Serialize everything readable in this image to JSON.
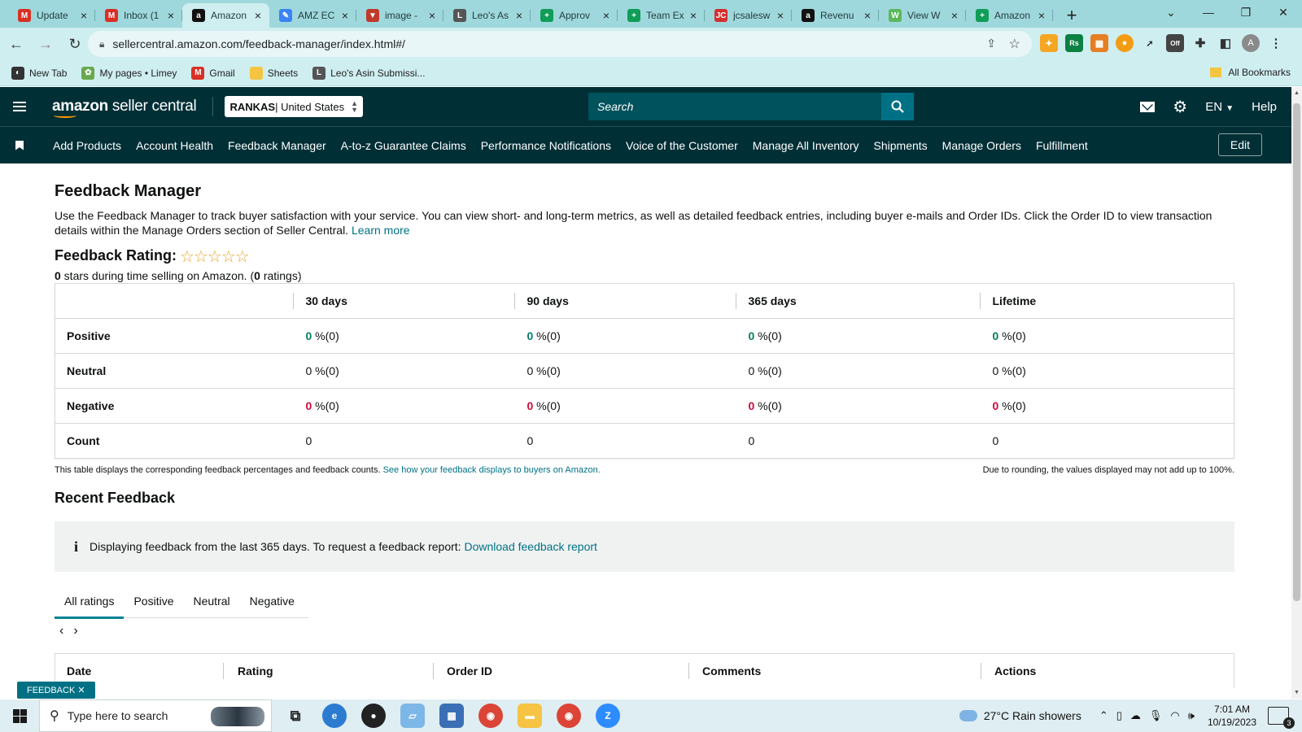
{
  "browser": {
    "tabs": [
      {
        "title": "Update",
        "icon": "gmail-icon",
        "color": "#d93025",
        "glyph": "M"
      },
      {
        "title": "Inbox (1",
        "icon": "gmail-icon",
        "color": "#d93025",
        "glyph": "M"
      },
      {
        "title": "Amazon",
        "icon": "amazon-icon",
        "color": "#111111",
        "glyph": "a"
      },
      {
        "title": "AMZ EC",
        "icon": "pen-icon",
        "color": "#3b82f6",
        "glyph": "✎"
      },
      {
        "title": "image -",
        "icon": "filter-icon",
        "color": "#c0392b",
        "glyph": "▼"
      },
      {
        "title": "Leo's As",
        "icon": "leo-icon",
        "color": "#555555",
        "glyph": "L"
      },
      {
        "title": "Approv",
        "icon": "sheets-plus-icon",
        "color": "#0f9d58",
        "glyph": "+"
      },
      {
        "title": "Team Ex",
        "icon": "sheets-plus-icon",
        "color": "#0f9d58",
        "glyph": "+"
      },
      {
        "title": "jcsalesw",
        "icon": "jc-icon",
        "color": "#d32f2f",
        "glyph": "JC"
      },
      {
        "title": "Revenu",
        "icon": "amazon-icon",
        "color": "#111111",
        "glyph": "a"
      },
      {
        "title": "View W",
        "icon": "w-icon",
        "color": "#5cb85c",
        "glyph": "W"
      },
      {
        "title": "Amazon",
        "icon": "sheets-plus-icon",
        "color": "#0f9d58",
        "glyph": "+"
      }
    ],
    "active_tab": 2,
    "url": "sellercentral.amazon.com/feedback-manager/index.html#/",
    "bookmarks": [
      {
        "label": "New Tab",
        "icon": "globe-icon",
        "color": "#333333",
        "glyph": "◐"
      },
      {
        "label": "My pages • Limey",
        "icon": "leaf-icon",
        "color": "#6aa84f",
        "glyph": "✿"
      },
      {
        "label": "Gmail",
        "icon": "gmail-icon",
        "color": "#d93025",
        "glyph": "M"
      },
      {
        "label": "Sheets",
        "icon": "folder-icon",
        "color": "#f4c542",
        "glyph": ""
      },
      {
        "label": "Leo's Asin Submissi...",
        "icon": "leo-icon",
        "color": "#555555",
        "glyph": "L"
      }
    ],
    "all_bookmarks": "All Bookmarks",
    "profile_initial": "A"
  },
  "header": {
    "logo_bold": "amazon",
    "logo_light": " seller central",
    "store_name": "RANKAS",
    "store_region": " | United States",
    "search_placeholder": "Search",
    "language": "EN",
    "help": "Help"
  },
  "nav": {
    "items": [
      "Add Products",
      "Account Health",
      "Feedback Manager",
      "A-to-z Guarantee Claims",
      "Performance Notifications",
      "Voice of the Customer",
      "Manage All Inventory",
      "Shipments",
      "Manage Orders",
      "Fulfillment"
    ],
    "edit": "Edit"
  },
  "page": {
    "title": "Feedback Manager",
    "intro": "Use the Feedback Manager to track buyer satisfaction with your service. You can view short- and long-term metrics, as well as detailed feedback entries, including buyer e-mails and Order IDs. Click the Order ID to view transaction details within the Manage Orders section of Seller Central. ",
    "learn_more": "Learn more",
    "rating_label": "Feedback Rating:",
    "stars": "☆☆☆☆☆",
    "rating_stars_value": "0",
    "rating_mid": " stars during time selling on Amazon. (",
    "rating_count": "0",
    "rating_end": " ratings)"
  },
  "metrics": {
    "columns": [
      "30 days",
      "90 days",
      "365 days",
      "Lifetime"
    ],
    "rows": [
      {
        "label": "Positive",
        "cls": "g",
        "cells": [
          {
            "n": "0",
            "s": " %(0)"
          },
          {
            "n": "0",
            "s": " %(0)"
          },
          {
            "n": "0",
            "s": " %(0)"
          },
          {
            "n": "0",
            "s": " %(0)"
          }
        ]
      },
      {
        "label": "Neutral",
        "cls": "n",
        "cells": [
          {
            "n": "0",
            "s": " %(0)"
          },
          {
            "n": "0",
            "s": " %(0)"
          },
          {
            "n": "0",
            "s": " %(0)"
          },
          {
            "n": "0",
            "s": " %(0)"
          }
        ]
      },
      {
        "label": "Negative",
        "cls": "r",
        "cells": [
          {
            "n": "0",
            "s": " %(0)"
          },
          {
            "n": "0",
            "s": " %(0)"
          },
          {
            "n": "0",
            "s": " %(0)"
          },
          {
            "n": "0",
            "s": " %(0)"
          }
        ]
      },
      {
        "label": "Count",
        "cls": "plain",
        "cells": [
          {
            "n": "0",
            "s": ""
          },
          {
            "n": "0",
            "s": ""
          },
          {
            "n": "0",
            "s": ""
          },
          {
            "n": "0",
            "s": ""
          }
        ]
      }
    ],
    "note": "This table displays the corresponding feedback percentages and feedback counts. ",
    "note_link": "See how your feedback displays to buyers on Amazon.",
    "rounding_note": "Due to rounding, the values displayed may not add up to 100%."
  },
  "recent": {
    "title": "Recent Feedback",
    "info_icon": "i",
    "info_text": "Displaying feedback from the last 365 days. To request a feedback report: ",
    "info_link": "Download feedback report",
    "tabs": [
      "All ratings",
      "Positive",
      "Neutral",
      "Negative"
    ],
    "prev": "‹",
    "next": "›",
    "columns": [
      "Date",
      "Rating",
      "Order ID",
      "Comments",
      "Actions"
    ]
  },
  "feedback_badge": "FEEDBACK ✕",
  "taskbar": {
    "search_placeholder": "Type here to search",
    "weather": "27°C  Rain showers",
    "time": "7:01 AM",
    "date": "10/19/2023",
    "notifications": "3"
  },
  "colors": {
    "header_bg": "#002f36",
    "link": "#007185",
    "positive": "#067d62",
    "negative": "#cc0c39",
    "tab_strip": "#9fd8dc"
  }
}
